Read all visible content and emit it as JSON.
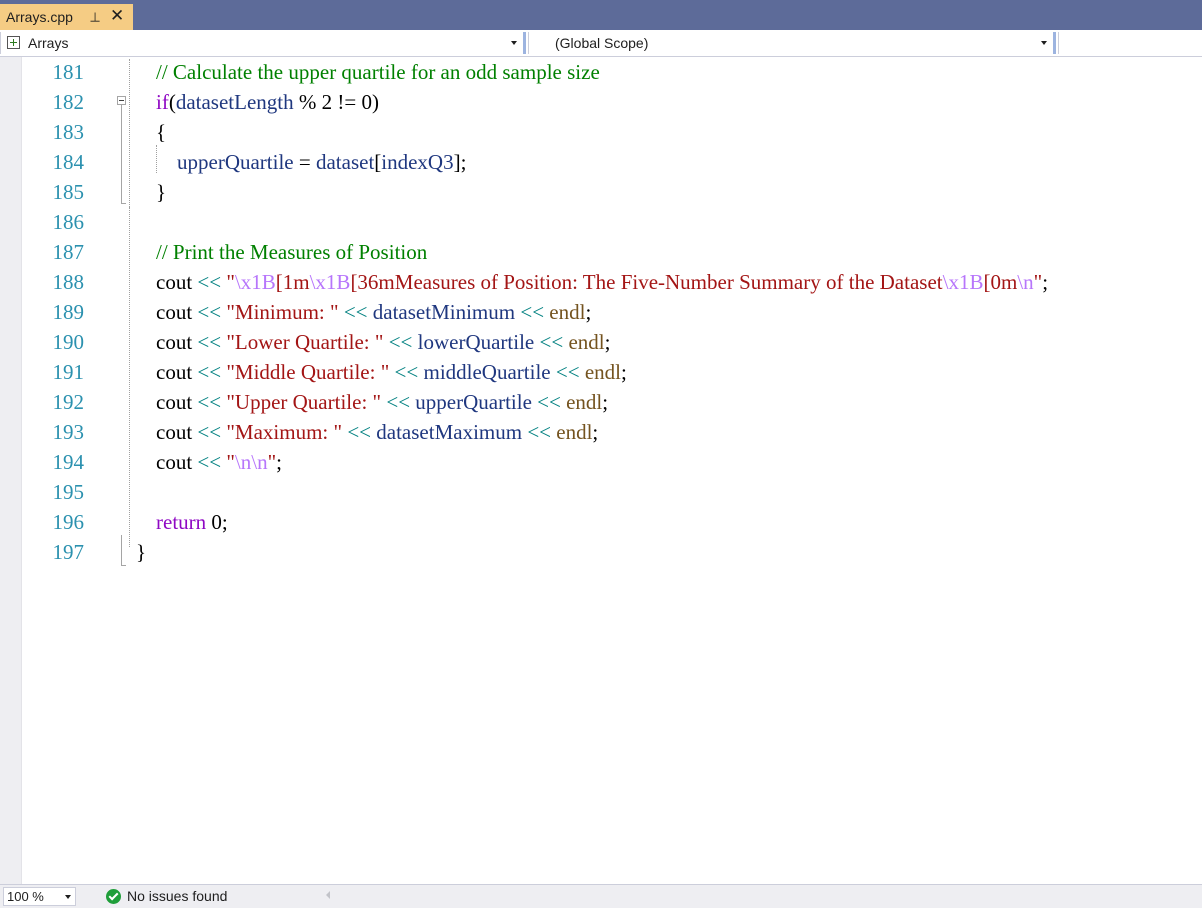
{
  "tab": {
    "title": "Arrays.cpp",
    "pin_icon": "pin-icon",
    "close_icon": "close-icon"
  },
  "navbar": {
    "project": "Arrays",
    "scope": "(Global Scope)"
  },
  "editor": {
    "line_numbers": [
      "181",
      "182",
      "183",
      "184",
      "185",
      "186",
      "187",
      "188",
      "189",
      "190",
      "191",
      "192",
      "193",
      "194",
      "195",
      "196",
      "197"
    ],
    "lines": [
      [
        [
          "cm",
          "// Calculate the upper quartile for an odd sample size"
        ]
      ],
      [
        [
          "kw",
          "if"
        ],
        [
          "",
          "("
        ],
        [
          "id",
          "datasetLength"
        ],
        [
          "",
          " % 2 != 0)"
        ]
      ],
      [
        [
          "",
          "{"
        ]
      ],
      [
        [
          "",
          "    "
        ],
        [
          "id",
          "upperQuartile"
        ],
        [
          "",
          " = "
        ],
        [
          "id",
          "dataset"
        ],
        [
          "",
          "["
        ],
        [
          "id",
          "indexQ3"
        ],
        [
          "",
          "];"
        ]
      ],
      [
        [
          "",
          "}"
        ]
      ],
      [],
      [
        [
          "cm",
          "// Print the Measures of Position"
        ]
      ],
      [
        [
          "",
          "cout "
        ],
        [
          "op",
          "<<"
        ],
        [
          "",
          " "
        ],
        [
          "st",
          "\""
        ],
        [
          "esc",
          "\\x1B"
        ],
        [
          "st",
          "[1m"
        ],
        [
          "esc",
          "\\x1B"
        ],
        [
          "st",
          "[36mMeasures of Position: The Five-Number Summary of the Dataset"
        ],
        [
          "esc",
          "\\x1B"
        ],
        [
          "st",
          "[0m"
        ],
        [
          "esc",
          "\\n"
        ],
        [
          "st",
          "\""
        ],
        [
          "",
          ";"
        ]
      ],
      [
        [
          "",
          "cout "
        ],
        [
          "op",
          "<<"
        ],
        [
          "",
          " "
        ],
        [
          "st",
          "\"Minimum: \""
        ],
        [
          "",
          " "
        ],
        [
          "op",
          "<<"
        ],
        [
          "",
          " "
        ],
        [
          "id",
          "datasetMinimum"
        ],
        [
          "",
          " "
        ],
        [
          "op",
          "<<"
        ],
        [
          "",
          " "
        ],
        [
          "fn",
          "endl"
        ],
        [
          "",
          ";"
        ]
      ],
      [
        [
          "",
          "cout "
        ],
        [
          "op",
          "<<"
        ],
        [
          "",
          " "
        ],
        [
          "st",
          "\"Lower Quartile: \""
        ],
        [
          "",
          " "
        ],
        [
          "op",
          "<<"
        ],
        [
          "",
          " "
        ],
        [
          "id",
          "lowerQuartile"
        ],
        [
          "",
          " "
        ],
        [
          "op",
          "<<"
        ],
        [
          "",
          " "
        ],
        [
          "fn",
          "endl"
        ],
        [
          "",
          ";"
        ]
      ],
      [
        [
          "",
          "cout "
        ],
        [
          "op",
          "<<"
        ],
        [
          "",
          " "
        ],
        [
          "st",
          "\"Middle Quartile: \""
        ],
        [
          "",
          " "
        ],
        [
          "op",
          "<<"
        ],
        [
          "",
          " "
        ],
        [
          "id",
          "middleQuartile"
        ],
        [
          "",
          " "
        ],
        [
          "op",
          "<<"
        ],
        [
          "",
          " "
        ],
        [
          "fn",
          "endl"
        ],
        [
          "",
          ";"
        ]
      ],
      [
        [
          "",
          "cout "
        ],
        [
          "op",
          "<<"
        ],
        [
          "",
          " "
        ],
        [
          "st",
          "\"Upper Quartile: \""
        ],
        [
          "",
          " "
        ],
        [
          "op",
          "<<"
        ],
        [
          "",
          " "
        ],
        [
          "id",
          "upperQuartile"
        ],
        [
          "",
          " "
        ],
        [
          "op",
          "<<"
        ],
        [
          "",
          " "
        ],
        [
          "fn",
          "endl"
        ],
        [
          "",
          ";"
        ]
      ],
      [
        [
          "",
          "cout "
        ],
        [
          "op",
          "<<"
        ],
        [
          "",
          " "
        ],
        [
          "st",
          "\"Maximum: \""
        ],
        [
          "",
          " "
        ],
        [
          "op",
          "<<"
        ],
        [
          "",
          " "
        ],
        [
          "id",
          "datasetMaximum"
        ],
        [
          "",
          " "
        ],
        [
          "op",
          "<<"
        ],
        [
          "",
          " "
        ],
        [
          "fn",
          "endl"
        ],
        [
          "",
          ";"
        ]
      ],
      [
        [
          "",
          "cout "
        ],
        [
          "op",
          "<<"
        ],
        [
          "",
          " "
        ],
        [
          "st",
          "\""
        ],
        [
          "esc",
          "\\n\\n"
        ],
        [
          "st",
          "\""
        ],
        [
          "",
          ";"
        ]
      ],
      [],
      [
        [
          "kw",
          "return"
        ],
        [
          "",
          " 0;"
        ]
      ],
      [
        [
          "",
          "}"
        ]
      ]
    ]
  },
  "statusbar": {
    "zoom": "100 %",
    "issues": "No issues found",
    "issues_icon": "check-circle-icon"
  },
  "colors": {
    "tabstrip": "#5d6b99",
    "active_tab": "#f5cc84",
    "line_number": "#2b91af",
    "comment": "#008000",
    "keyword": "#8f08c4",
    "identifier": "#1f377f",
    "string": "#a31515",
    "escape": "#b776fb",
    "operator": "#008080",
    "function": "#74531f"
  }
}
